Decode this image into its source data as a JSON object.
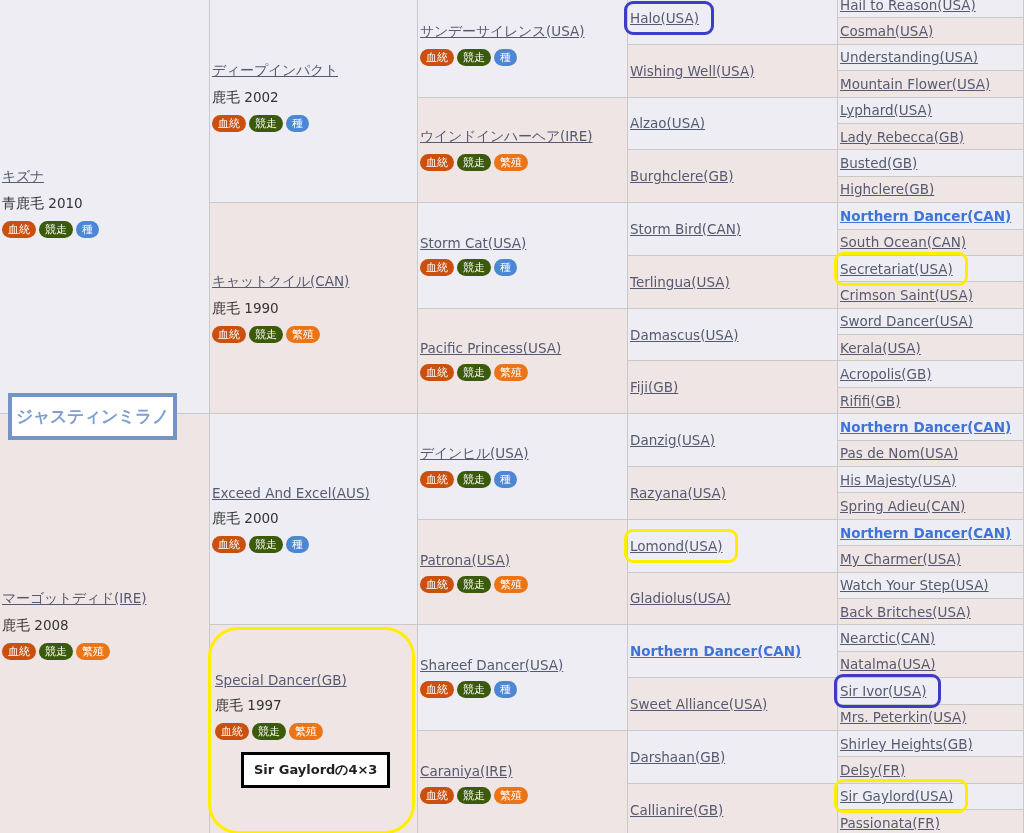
{
  "pedigree": {
    "name": "ジャスティンミラノ",
    "children": [
      {
        "name": "キズナ",
        "coat": "青鹿毛 2010",
        "inbred": false,
        "badges": [
          {
            "label": "血統",
            "kind": "pedigree"
          },
          {
            "label": "競走",
            "kind": "racing"
          },
          {
            "label": "種",
            "kind": "stallion"
          }
        ],
        "children": [
          {
            "name": "ディープインパクト",
            "coat": "鹿毛 2002",
            "inbred": false,
            "badges": [
              {
                "label": "血統",
                "kind": "pedigree"
              },
              {
                "label": "競走",
                "kind": "racing"
              },
              {
                "label": "種",
                "kind": "stallion"
              }
            ],
            "children": [
              {
                "name": "サンデーサイレンス(USA)",
                "inbred": false,
                "badges": [
                  {
                    "label": "血統",
                    "kind": "pedigree"
                  },
                  {
                    "label": "競走",
                    "kind": "racing"
                  },
                  {
                    "label": "種",
                    "kind": "stallion"
                  }
                ],
                "children": [
                  {
                    "name": "Halo(USA)",
                    "inbred": false,
                    "color": "#3c3cc8",
                    "children": [
                      {
                        "name": "Hail to Reason(USA)",
                        "inbred": false
                      },
                      {
                        "name": "Cosmah(USA)",
                        "inbred": false
                      }
                    ]
                  },
                  {
                    "name": "Wishing Well(USA)",
                    "inbred": false,
                    "children": [
                      {
                        "name": "Understanding(USA)",
                        "inbred": false
                      },
                      {
                        "name": "Mountain Flower(USA)",
                        "inbred": false
                      }
                    ]
                  }
                ]
              },
              {
                "name": "ウインドインハーヘア(IRE)",
                "inbred": false,
                "badges": [
                  {
                    "label": "血統",
                    "kind": "pedigree"
                  },
                  {
                    "label": "競走",
                    "kind": "racing"
                  },
                  {
                    "label": "繁殖",
                    "kind": "broodmare"
                  }
                ],
                "children": [
                  {
                    "name": "Alzao(USA)",
                    "inbred": false,
                    "children": [
                      {
                        "name": "Lyphard(USA)",
                        "inbred": false
                      },
                      {
                        "name": "Lady Rebecca(GB)",
                        "inbred": false
                      }
                    ]
                  },
                  {
                    "name": "Burghclere(GB)",
                    "inbred": false,
                    "children": [
                      {
                        "name": "Busted(GB)",
                        "inbred": false
                      },
                      {
                        "name": "Highclere(GB)",
                        "inbred": false
                      }
                    ]
                  }
                ]
              }
            ]
          },
          {
            "name": "キャットクイル(CAN)",
            "coat": "鹿毛 1990",
            "inbred": false,
            "badges": [
              {
                "label": "血統",
                "kind": "pedigree"
              },
              {
                "label": "競走",
                "kind": "racing"
              },
              {
                "label": "繁殖",
                "kind": "broodmare"
              }
            ],
            "children": [
              {
                "name": "Storm Cat(USA)",
                "inbred": false,
                "badges": [
                  {
                    "label": "血統",
                    "kind": "pedigree"
                  },
                  {
                    "label": "競走",
                    "kind": "racing"
                  },
                  {
                    "label": "種",
                    "kind": "stallion"
                  }
                ],
                "children": [
                  {
                    "name": "Storm Bird(CAN)",
                    "inbred": false,
                    "children": [
                      {
                        "name": "Northern Dancer(CAN)",
                        "inbred": true
                      },
                      {
                        "name": "South Ocean(CAN)",
                        "inbred": false
                      }
                    ]
                  },
                  {
                    "name": "Terlingua(USA)",
                    "inbred": false,
                    "children": [
                      {
                        "name": "Secretariat(USA)",
                        "inbred": false,
                        "color": "#ffee00"
                      },
                      {
                        "name": "Crimson Saint(USA)",
                        "inbred": false
                      }
                    ]
                  }
                ]
              },
              {
                "name": "Pacific Princess(USA)",
                "inbred": false,
                "badges": [
                  {
                    "label": "血統",
                    "kind": "pedigree"
                  },
                  {
                    "label": "競走",
                    "kind": "racing"
                  },
                  {
                    "label": "繁殖",
                    "kind": "broodmare"
                  }
                ],
                "children": [
                  {
                    "name": "Damascus(USA)",
                    "inbred": false,
                    "children": [
                      {
                        "name": "Sword Dancer(USA)",
                        "inbred": false
                      },
                      {
                        "name": "Kerala(USA)",
                        "inbred": false
                      }
                    ]
                  },
                  {
                    "name": "Fiji(GB)",
                    "inbred": false,
                    "children": [
                      {
                        "name": "Acropolis(GB)",
                        "inbred": false
                      },
                      {
                        "name": "Rififi(GB)",
                        "inbred": false
                      }
                    ]
                  }
                ]
              }
            ]
          }
        ]
      },
      {
        "name": "マーゴットディド(IRE)",
        "coat": "鹿毛 2008",
        "inbred": false,
        "badges": [
          {
            "label": "血統",
            "kind": "pedigree"
          },
          {
            "label": "競走",
            "kind": "racing"
          },
          {
            "label": "繁殖",
            "kind": "broodmare"
          }
        ],
        "children": [
          {
            "name": "Exceed And Excel(AUS)",
            "coat": "鹿毛 2000",
            "inbred": false,
            "badges": [
              {
                "label": "血統",
                "kind": "pedigree"
              },
              {
                "label": "競走",
                "kind": "racing"
              },
              {
                "label": "種",
                "kind": "stallion"
              }
            ],
            "children": [
              {
                "name": "デインヒル(USA)",
                "inbred": false,
                "badges": [
                  {
                    "label": "血統",
                    "kind": "pedigree"
                  },
                  {
                    "label": "競走",
                    "kind": "racing"
                  },
                  {
                    "label": "種",
                    "kind": "stallion"
                  }
                ],
                "children": [
                  {
                    "name": "Danzig(USA)",
                    "inbred": false,
                    "children": [
                      {
                        "name": "Northern Dancer(CAN)",
                        "inbred": true
                      },
                      {
                        "name": "Pas de Nom(USA)",
                        "inbred": false
                      }
                    ]
                  },
                  {
                    "name": "Razyana(USA)",
                    "inbred": false,
                    "children": [
                      {
                        "name": "His Majesty(USA)",
                        "inbred": false
                      },
                      {
                        "name": "Spring Adieu(CAN)",
                        "inbred": false
                      }
                    ]
                  }
                ]
              },
              {
                "name": "Patrona(USA)",
                "inbred": false,
                "badges": [
                  {
                    "label": "血統",
                    "kind": "pedigree"
                  },
                  {
                    "label": "競走",
                    "kind": "racing"
                  },
                  {
                    "label": "繁殖",
                    "kind": "broodmare"
                  }
                ],
                "children": [
                  {
                    "name": "Lomond(USA)",
                    "inbred": false,
                    "color": "#ffee00",
                    "children": [
                      {
                        "name": "Northern Dancer(CAN)",
                        "inbred": true
                      },
                      {
                        "name": "My Charmer(USA)",
                        "inbred": false
                      }
                    ]
                  },
                  {
                    "name": "Gladiolus(USA)",
                    "inbred": false,
                    "children": [
                      {
                        "name": "Watch Your Step(USA)",
                        "inbred": false
                      },
                      {
                        "name": "Back Britches(USA)",
                        "inbred": false
                      }
                    ]
                  }
                ]
              }
            ]
          },
          {
            "name": "Special Dancer(GB)",
            "coat": "鹿毛 1997",
            "inbred": false,
            "color": "#ffee00",
            "note": "Sir Gaylordの4×3",
            "badges": [
              {
                "label": "血統",
                "kind": "pedigree"
              },
              {
                "label": "競走",
                "kind": "racing"
              },
              {
                "label": "繁殖",
                "kind": "broodmare"
              }
            ],
            "children": [
              {
                "name": "Shareef Dancer(USA)",
                "inbred": false,
                "badges": [
                  {
                    "label": "血統",
                    "kind": "pedigree"
                  },
                  {
                    "label": "競走",
                    "kind": "racing"
                  },
                  {
                    "label": "種",
                    "kind": "stallion"
                  }
                ],
                "children": [
                  {
                    "name": "Northern Dancer(CAN)",
                    "inbred": true,
                    "children": [
                      {
                        "name": "Nearctic(CAN)",
                        "inbred": false
                      },
                      {
                        "name": "Natalma(USA)",
                        "inbred": false
                      }
                    ]
                  },
                  {
                    "name": "Sweet Alliance(USA)",
                    "inbred": false,
                    "children": [
                      {
                        "name": "Sir Ivor(USA)",
                        "inbred": false,
                        "color": "#3c3cc8"
                      },
                      {
                        "name": "Mrs. Peterkin(USA)",
                        "inbred": false
                      }
                    ]
                  }
                ]
              },
              {
                "name": "Caraniya(IRE)",
                "inbred": false,
                "badges": [
                  {
                    "label": "血統",
                    "kind": "pedigree"
                  },
                  {
                    "label": "競走",
                    "kind": "racing"
                  },
                  {
                    "label": "繁殖",
                    "kind": "broodmare"
                  }
                ],
                "children": [
                  {
                    "name": "Darshaan(GB)",
                    "inbred": false,
                    "children": [
                      {
                        "name": "Shirley Heights(GB)",
                        "inbred": false
                      },
                      {
                        "name": "Delsy(FR)",
                        "inbred": false
                      }
                    ]
                  },
                  {
                    "name": "Callianire(GB)",
                    "inbred": false,
                    "children": [
                      {
                        "name": "Sir Gaylord(USA)",
                        "inbred": false,
                        "color": "#ffee00"
                      },
                      {
                        "name": "Passionata(FR)",
                        "inbred": false
                      }
                    ]
                  }
                ]
              }
            ]
          }
        ]
      }
    ]
  }
}
